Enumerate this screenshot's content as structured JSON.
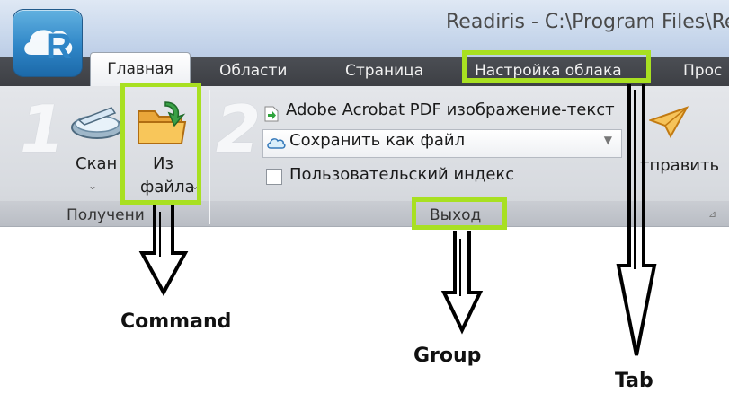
{
  "window": {
    "title": "Readiris - C:\\Program Files\\Re"
  },
  "tabs": [
    {
      "label": "Главная"
    },
    {
      "label": "Области"
    },
    {
      "label": "Страница"
    },
    {
      "label": "Настройка облака"
    },
    {
      "label": "Прос"
    }
  ],
  "steps": {
    "one": "1",
    "two": "2"
  },
  "acquire": {
    "scan_label": "Скан",
    "from_file_label_line1": "Из",
    "from_file_label_line2": "файла",
    "group_label": "Получени"
  },
  "output": {
    "format_label": "Adobe Acrobat PDF изображение-текст",
    "destination_value": "Сохранить как файл",
    "custom_index_label": "Пользовательский индекс",
    "group_label": "Выход"
  },
  "send": {
    "label": "тправить"
  },
  "annotations": {
    "command": "Command",
    "group": "Group",
    "tab": "Tab"
  },
  "colors": {
    "highlight": "#a8e021",
    "tabstrip": "#44474c",
    "ribbon": "#dcdfe3"
  }
}
